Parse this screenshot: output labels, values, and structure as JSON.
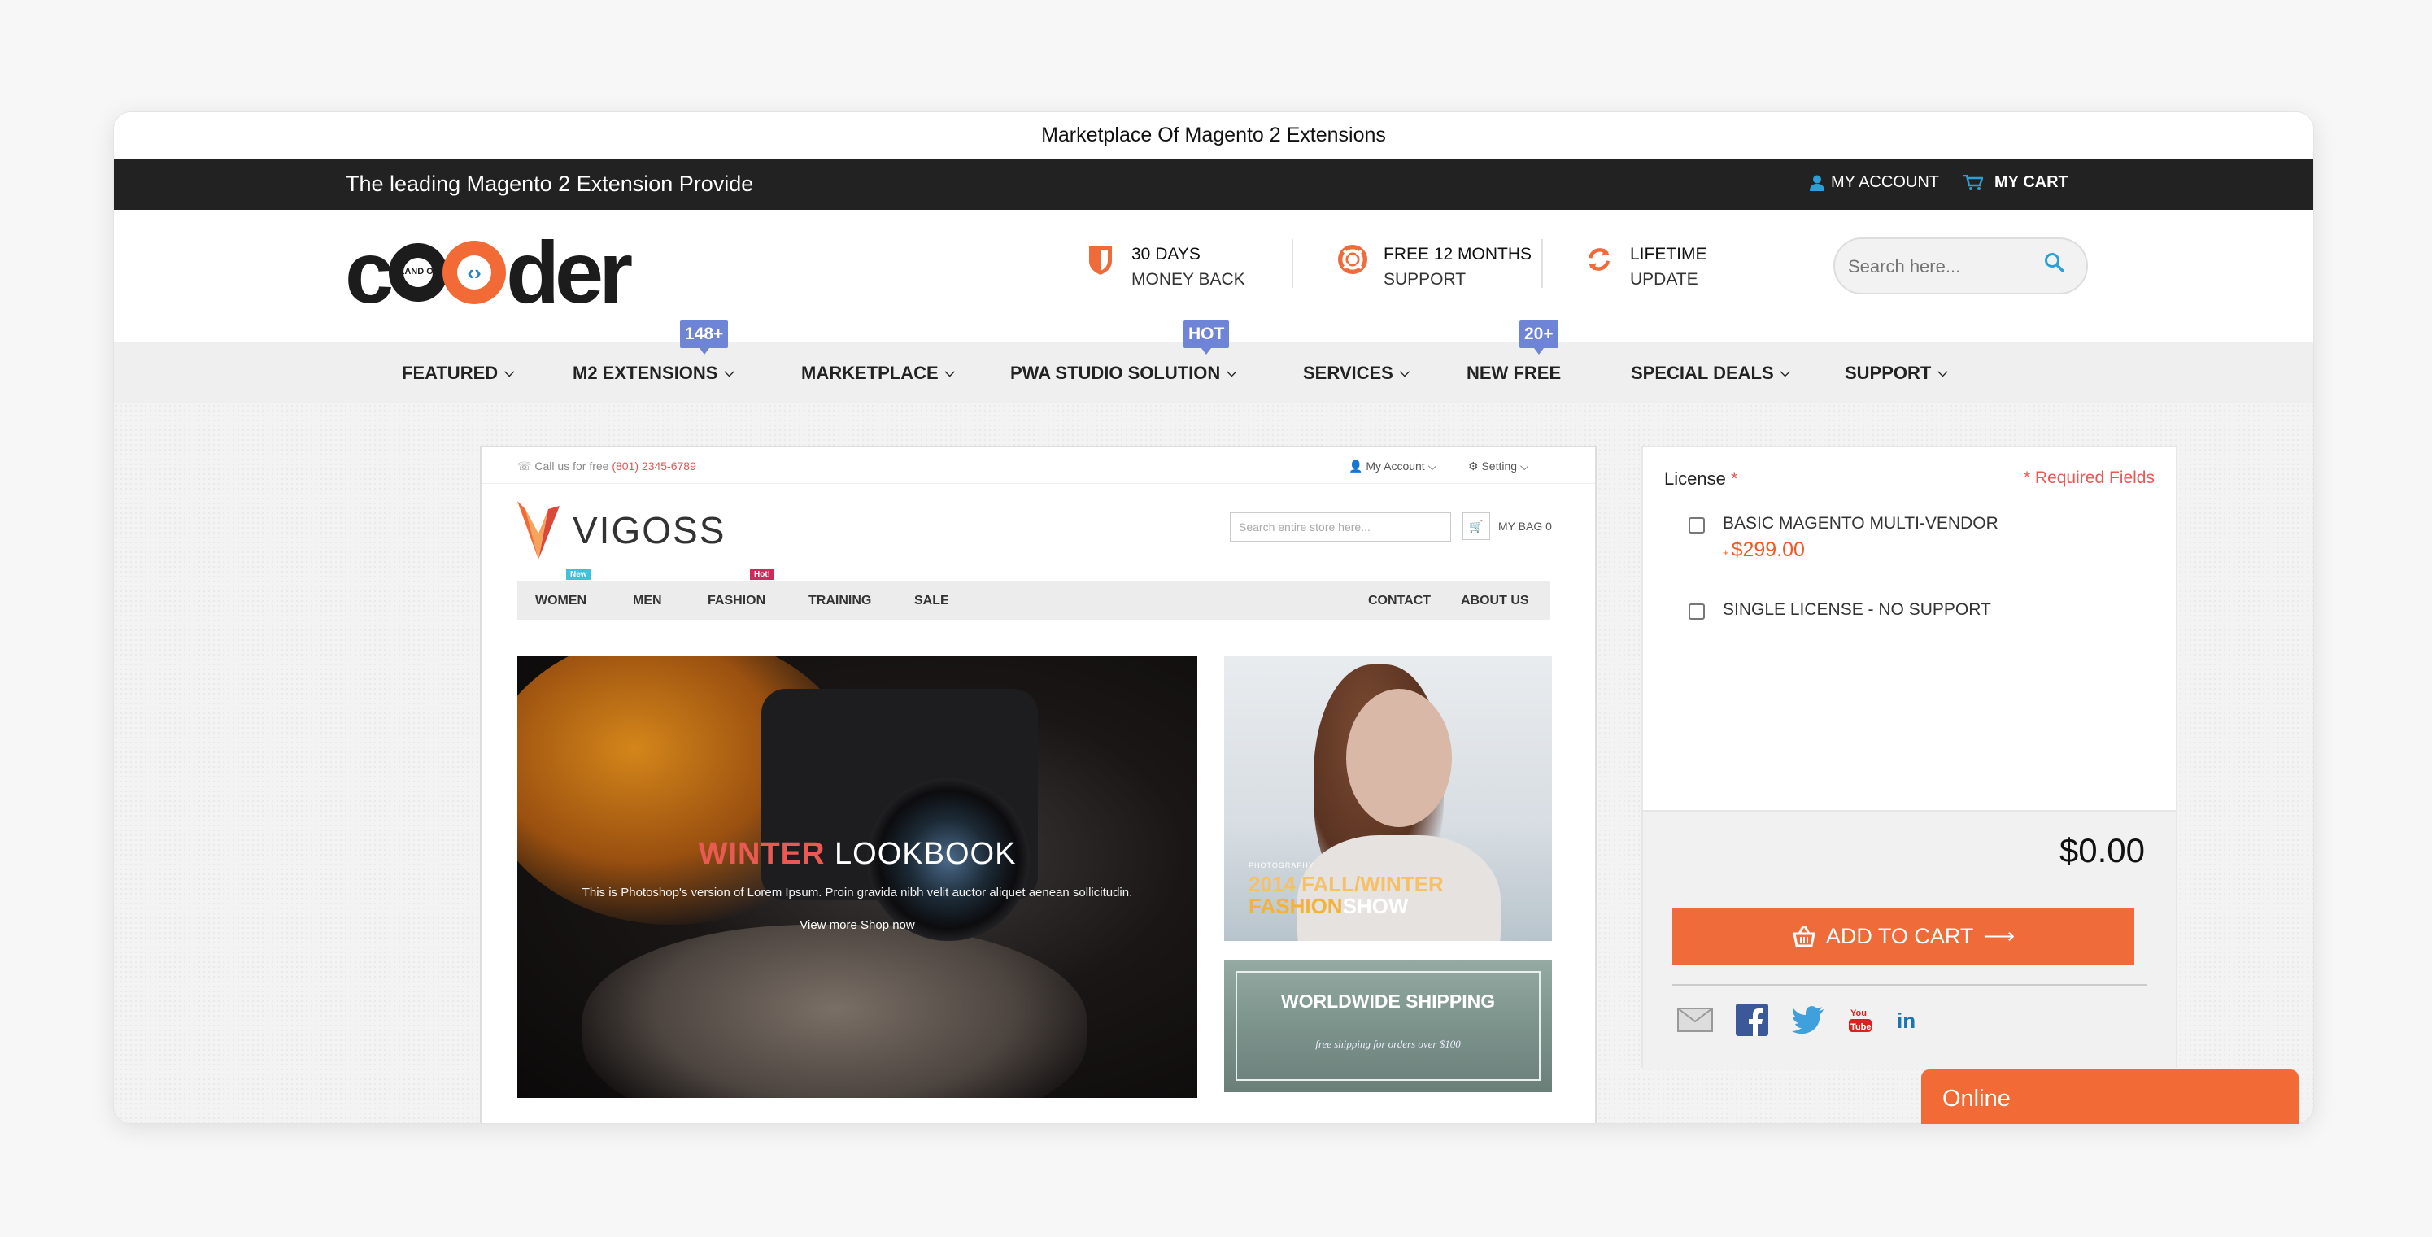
{
  "window": {
    "title": "Marketplace Of Magento 2 Extensions"
  },
  "topbar": {
    "tagline": "The leading Magento 2 Extension Provide",
    "my_account": "MY ACCOUNT",
    "my_cart": "MY CART"
  },
  "logo": {
    "text_pre": "c",
    "text_post": "der",
    "badge": "LAND OF"
  },
  "features": [
    {
      "line1": "30 DAYS",
      "line2": "MONEY BACK",
      "icon": "shield-icon"
    },
    {
      "line1": "FREE 12 MONTHS",
      "line2": "SUPPORT",
      "icon": "lifebuoy-icon"
    },
    {
      "line1": "LIFETIME",
      "line2": "UPDATE",
      "icon": "refresh-icon"
    }
  ],
  "search": {
    "placeholder": "Search here..."
  },
  "nav": {
    "items": [
      {
        "label": "FEATURED"
      },
      {
        "label": "M2 EXTENSIONS",
        "badge": "148+"
      },
      {
        "label": "MARKETPLACE"
      },
      {
        "label": "PWA STUDIO SOLUTION",
        "badge": "HOT"
      },
      {
        "label": "SERVICES"
      },
      {
        "label": "NEW FREE",
        "badge": "20+"
      },
      {
        "label": "SPECIAL DEALS"
      },
      {
        "label": "SUPPORT"
      }
    ]
  },
  "preview": {
    "call_label": "Call us for free",
    "phone": "(801) 2345-6789",
    "my_account": "My Account",
    "setting": "Setting",
    "brand": "VIGOSS",
    "search_placeholder": "Search entire store here...",
    "bag": "MY BAG 0",
    "nav": [
      "WOMEN",
      "MEN",
      "FASHION",
      "TRAINING",
      "SALE",
      "CONTACT",
      "ABOUT US"
    ],
    "tag_new": "New",
    "tag_hot": "Hot!",
    "hero_title_1": "WINTER",
    "hero_title_2": " LOOKBOOK",
    "hero_desc": "This is Photoshop's version of Lorem Ipsum. Proin gravida nibh velit auctor aliquet aenean sollicitudin.",
    "hero_more": "View more Shop now",
    "promo_tag": "PHOTOGRAPHY",
    "promo_line1": "2014 FALL/WINTER",
    "promo_line2_a": "FASHION",
    "promo_line2_b": "SHOW",
    "ship_title": "WORLDWIDE SHIPPING",
    "ship_sub": "free shipping for orders over $100"
  },
  "panel": {
    "license_label": "License",
    "required_star": " *",
    "required_note": "* Required Fields",
    "options": [
      {
        "label": "BASIC MAGENTO MULTI-VENDOR",
        "price": "$299.00",
        "price_prefix": "+",
        "checked": false
      },
      {
        "label": "SINGLE LICENSE - NO SUPPORT",
        "checked": false
      }
    ],
    "total": "$0.00",
    "add_to_cart": "ADD TO CART"
  },
  "social": [
    "email-icon",
    "facebook-icon",
    "twitter-icon",
    "youtube-icon",
    "linkedin-icon"
  ],
  "chat": {
    "status": "Online"
  },
  "colors": {
    "accent": "#ef6c3a",
    "topbar": "#222222",
    "badge": "#6e84d6",
    "price": "#f05a26",
    "link_blue": "#2a84c5"
  }
}
